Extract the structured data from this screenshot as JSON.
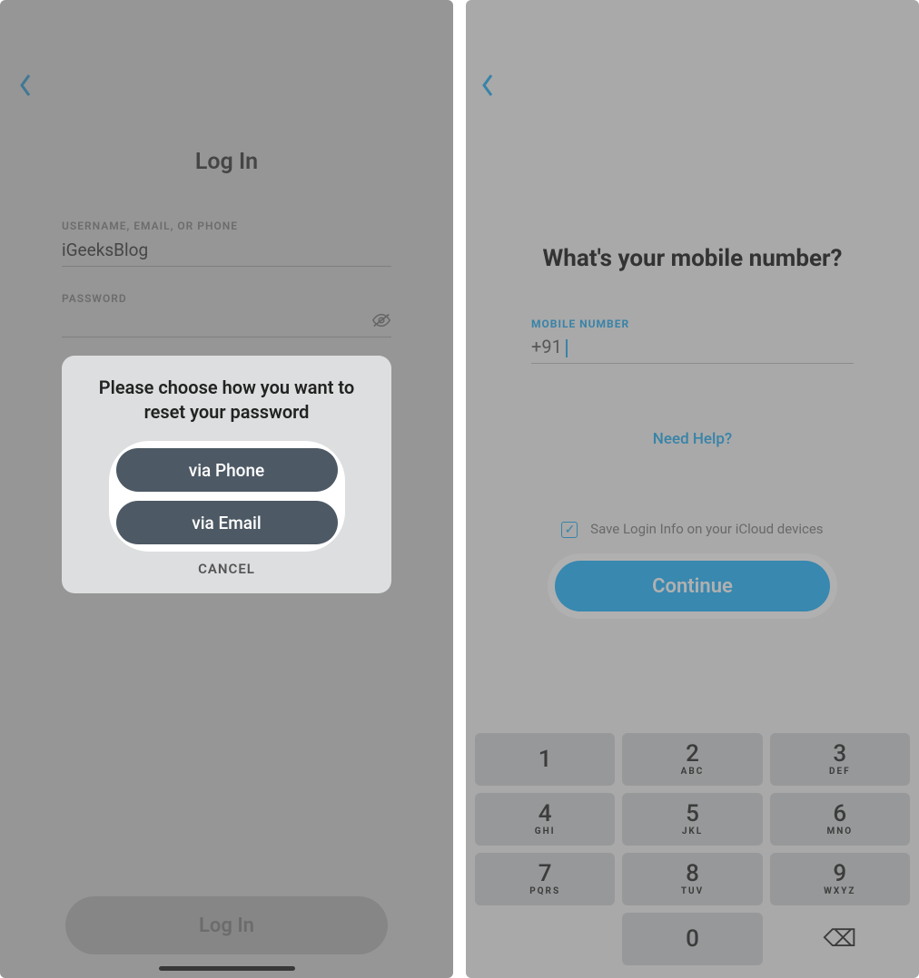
{
  "left": {
    "page_title": "Log In",
    "username_label": "USERNAME, EMAIL, OR PHONE",
    "username_value": "iGeeksBlog",
    "password_label": "PASSWORD",
    "password_value": "",
    "login_button": "Log In",
    "modal": {
      "title": "Please choose how you want to reset your password",
      "via_phone": "via Phone",
      "via_email": "via Email",
      "cancel": "CANCEL"
    }
  },
  "right": {
    "heading": "What's your mobile number?",
    "mobile_label": "MOBILE NUMBER",
    "mobile_value": "+91",
    "help_link": "Need Help?",
    "save_label": "Save Login Info on your iCloud devices",
    "continue_button": "Continue",
    "keypad": [
      {
        "digit": "1",
        "letters": ""
      },
      {
        "digit": "2",
        "letters": "ABC"
      },
      {
        "digit": "3",
        "letters": "DEF"
      },
      {
        "digit": "4",
        "letters": "GHI"
      },
      {
        "digit": "5",
        "letters": "JKL"
      },
      {
        "digit": "6",
        "letters": "MNO"
      },
      {
        "digit": "7",
        "letters": "PQRS"
      },
      {
        "digit": "8",
        "letters": "TUV"
      },
      {
        "digit": "9",
        "letters": "WXYZ"
      },
      {
        "digit": "0",
        "letters": ""
      }
    ]
  }
}
